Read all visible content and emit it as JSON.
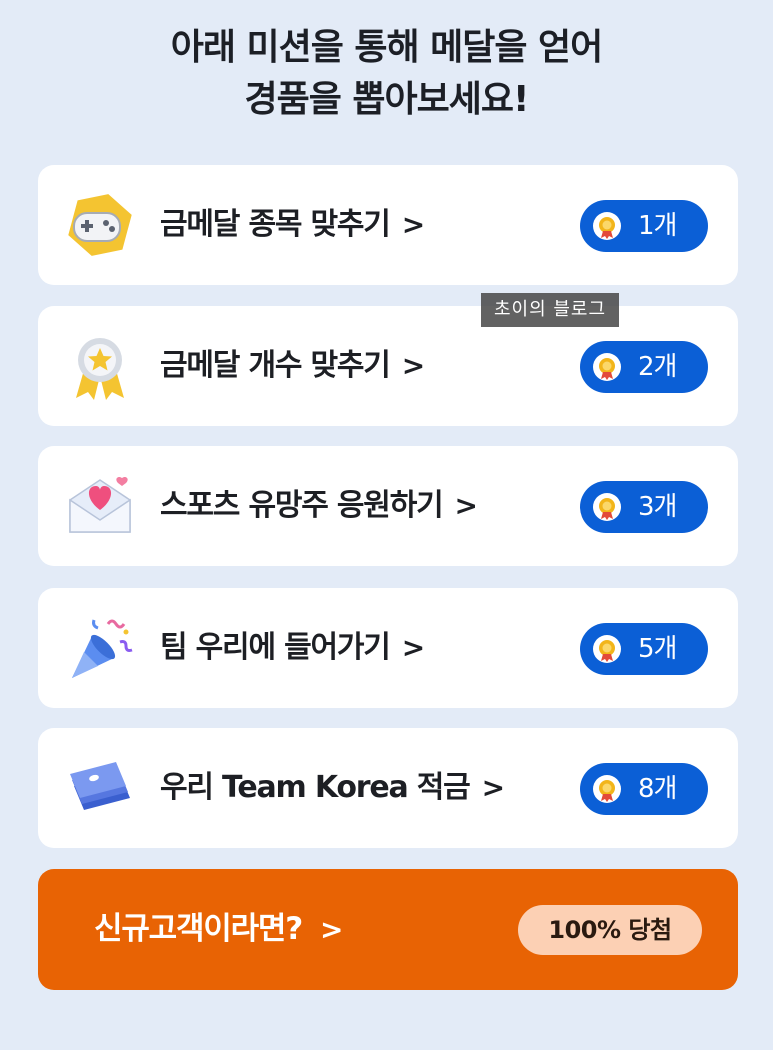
{
  "headline": {
    "line1": "아래 미션을 통해 메달을 얻어",
    "line2": "경품을 뽑아보세요!"
  },
  "missions": [
    {
      "label": "금메달 종목 맞추기",
      "arrow": ">",
      "reward": "1개",
      "icon": "gamepad-icon"
    },
    {
      "label": "금메달 개수 맞추기",
      "arrow": ">",
      "reward": "2개",
      "icon": "award-ribbon-icon"
    },
    {
      "label": "스포츠 유망주 응원하기",
      "arrow": ">",
      "reward": "3개",
      "icon": "heart-envelope-icon"
    },
    {
      "label": "팀 우리에 들어가기",
      "arrow": ">",
      "reward": "5개",
      "icon": "party-popper-icon"
    },
    {
      "label": "우리 Team Korea 적금",
      "arrow": ">",
      "reward": "8개",
      "icon": "bankbook-icon"
    }
  ],
  "watermark": "초이의 블로그",
  "cta": {
    "label": "신규고객이라면?",
    "arrow": ">",
    "badge": "100% 당첨"
  },
  "colors": {
    "background": "#e3ebf7",
    "pill": "#0b5fd6",
    "cta": "#e86304",
    "cta_badge": "#fcd0b4"
  }
}
